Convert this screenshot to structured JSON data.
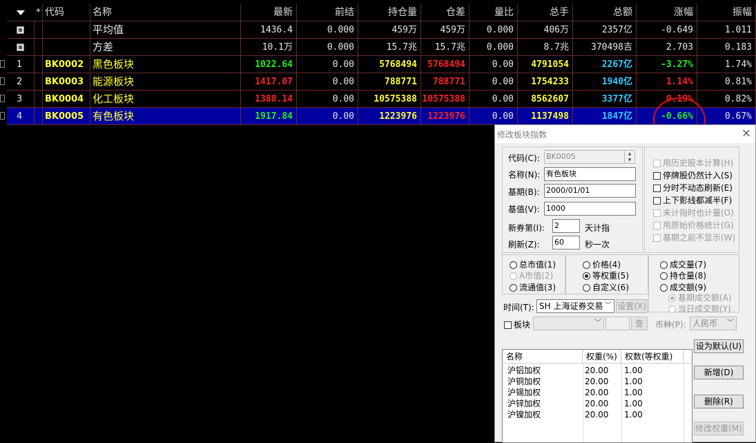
{
  "grid": {
    "headers": [
      "*",
      "代码",
      "名称",
      "最新",
      "前结",
      "持仓量",
      "仓差",
      "量比",
      "总手",
      "总额",
      "涨幅",
      "振幅"
    ],
    "stat_rows": [
      {
        "name": "平均值",
        "latest": "1436.4",
        "prev_settle": "0.000",
        "open_interest": "459万",
        "oi_change": "459万",
        "vol_ratio": "0.000",
        "total_lots": "406万",
        "total_amount": "2357亿",
        "change_pct": "-0.649",
        "amplitude": "1.011"
      },
      {
        "name": "方差",
        "latest": "10.1万",
        "prev_settle": "0.000",
        "open_interest": "15.7兆",
        "oi_change": "15.7兆",
        "vol_ratio": "0.000",
        "total_lots": "8.7兆",
        "total_amount": "370498吉",
        "change_pct": "2.703",
        "amplitude": "0.183"
      }
    ],
    "data_rows": [
      {
        "index": "1",
        "code": "BK0002",
        "name": "黑色板块",
        "latest": "1022.64",
        "latest_color": "green",
        "prev_settle": "0.00",
        "open_interest": "5768494",
        "oi_change": "5768494",
        "vol_ratio": "0.00",
        "total_lots": "4791054",
        "total_amount": "2267亿",
        "change_pct": "-3.27%",
        "change_color": "green",
        "amplitude": "1.74%"
      },
      {
        "index": "2",
        "code": "BK0003",
        "name": "能源板块",
        "latest": "1417.07",
        "latest_color": "red",
        "prev_settle": "0.00",
        "open_interest": "788771",
        "oi_change": "788771",
        "vol_ratio": "0.00",
        "total_lots": "1754233",
        "total_amount": "1940亿",
        "change_pct": "1.14%",
        "change_color": "red",
        "amplitude": "0.81%"
      },
      {
        "index": "3",
        "code": "BK0004",
        "name": "化工板块",
        "latest": "1388.14",
        "latest_color": "red",
        "prev_settle": "0.00",
        "open_interest": "10575388",
        "oi_change": "10575388",
        "vol_ratio": "0.00",
        "total_lots": "8562607",
        "total_amount": "3377亿",
        "change_pct": "0.19%",
        "change_color": "red",
        "amplitude": "0.82%"
      },
      {
        "index": "4",
        "code": "BK0005",
        "name": "有色板块",
        "latest": "1917.84",
        "latest_color": "green",
        "prev_settle": "0.00",
        "open_interest": "1223976",
        "oi_change": "1223976",
        "vol_ratio": "0.00",
        "total_lots": "1137498",
        "total_amount": "1847亿",
        "change_pct": "-0.66%",
        "change_color": "green",
        "amplitude": "0.67%",
        "selected": true
      }
    ]
  },
  "dialog": {
    "title": "修改板块指数",
    "close": "×",
    "code_label": "代码(C):",
    "code_value": "BK0005",
    "name_label": "名称(N):",
    "name_value": "有色板块",
    "base_date_label": "基期(B):",
    "base_date_value": "2000/01/01",
    "base_value_label": "基值(V):",
    "base_value_value": "1000",
    "new_issue_label": "新券第(I):",
    "new_issue_value": "2",
    "new_issue_suffix": "天计指",
    "refresh_label": "刷新(Z):",
    "refresh_value": "60",
    "refresh_suffix": "秒一次",
    "options": [
      {
        "label": "用历史股本计算(H)",
        "checked": false,
        "disabled": true
      },
      {
        "label": "停牌股仍然计入(S)",
        "checked": false,
        "disabled": false
      },
      {
        "label": "分时不动态刷新(E)",
        "checked": false,
        "disabled": false
      },
      {
        "label": "上下影线都减半(F)",
        "checked": false,
        "disabled": false
      },
      {
        "label": "未计指时也计量(O)",
        "checked": false,
        "disabled": true
      },
      {
        "label": "用原始价格统计(G)",
        "checked": false,
        "disabled": true
      },
      {
        "label": "基期之前不显示(W)",
        "checked": false,
        "disabled": true
      }
    ],
    "weight_col1": [
      {
        "label": "总市值(1)",
        "on": false,
        "disabled": false
      },
      {
        "label": "A市值(2)",
        "on": false,
        "disabled": true
      },
      {
        "label": "流通值(3)",
        "on": false,
        "disabled": false
      }
    ],
    "weight_col2": [
      {
        "label": "价格(4)",
        "on": false,
        "disabled": false
      },
      {
        "label": "等权重(5)",
        "on": true,
        "disabled": false
      },
      {
        "label": "自定义(6)",
        "on": false,
        "disabled": false
      }
    ],
    "weight_col3": [
      {
        "label": "成交量(7)",
        "on": false,
        "disabled": false
      },
      {
        "label": "持仓量(8)",
        "on": false,
        "disabled": false
      },
      {
        "label": "成交额(9)",
        "on": false,
        "disabled": false
      }
    ],
    "amount_sub": [
      {
        "label": "基期成交额(A)",
        "on": true,
        "disabled": true
      },
      {
        "label": "当日成交额(Y)",
        "on": false,
        "disabled": true
      }
    ],
    "time_label": "时间(T):",
    "time_value": "SH 上海证券交易",
    "settings_button": "设置(X)",
    "block_label": "板块",
    "block_value": "",
    "query_button": "查",
    "currency_label": "币种(P):",
    "currency_value": "人民币",
    "list_headers": [
      "名称",
      "权重(%)",
      "权数(等权重)"
    ],
    "list_rows": [
      {
        "name": "沪铝加权",
        "weight": "20.00",
        "factor": "1.00"
      },
      {
        "name": "沪铜加权",
        "weight": "20.00",
        "factor": "1.00"
      },
      {
        "name": "沪锡加权",
        "weight": "20.00",
        "factor": "1.00"
      },
      {
        "name": "沪锌加权",
        "weight": "20.00",
        "factor": "1.00"
      },
      {
        "name": "沪镍加权",
        "weight": "20.00",
        "factor": "1.00"
      }
    ],
    "set_default_button": "设为默认(U)",
    "add_button": "新增(D)",
    "delete_button": "删除(R)",
    "modify_weight_button": "修改权重(M)"
  }
}
